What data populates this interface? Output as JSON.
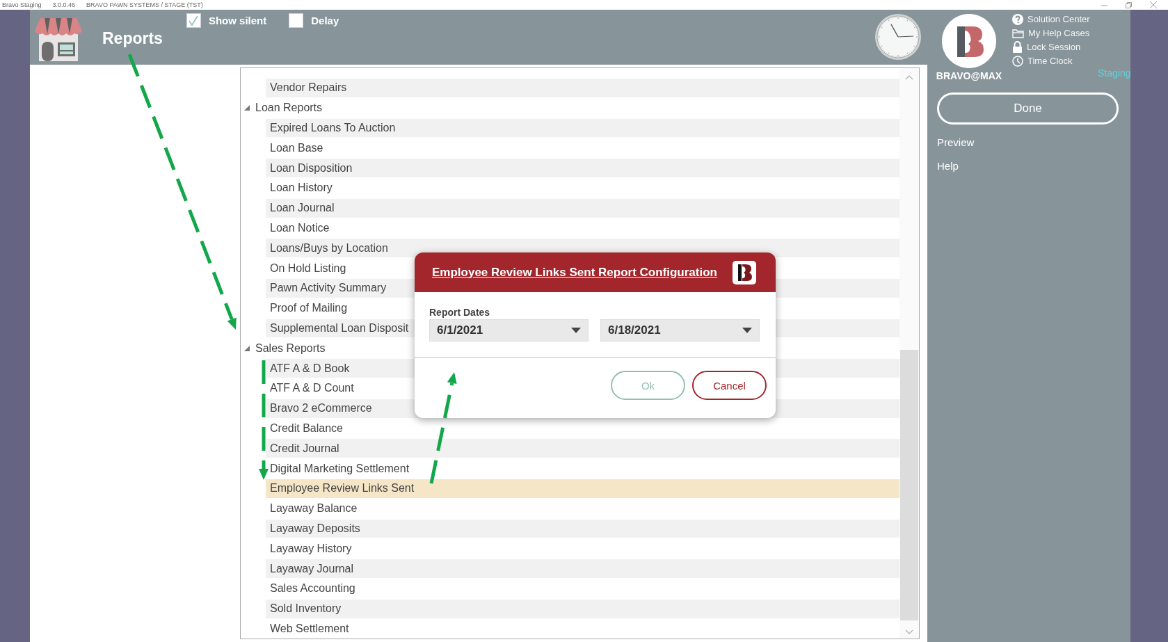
{
  "title_bar": {
    "app": "Bravo Staging",
    "version": "3.0.0.46",
    "system": "BRAVO PAWN SYSTEMS / STAGE (TST)"
  },
  "header": {
    "title": "Reports",
    "options": [
      {
        "label": "Show silent",
        "checked": true
      },
      {
        "label": "Delay",
        "checked": false
      }
    ]
  },
  "report_list": {
    "scrolled_group_items": [
      {
        "label": "Vendor Repairs",
        "selected": false
      }
    ],
    "groups": [
      {
        "label": "Loan Reports",
        "expanded": true,
        "children": [
          {
            "label": "Expired Loans To Auction",
            "selected": false
          },
          {
            "label": "Loan Base",
            "selected": false
          },
          {
            "label": "Loan Disposition",
            "selected": false
          },
          {
            "label": "Loan History",
            "selected": false
          },
          {
            "label": "Loan Journal",
            "selected": false
          },
          {
            "label": "Loan Notice",
            "selected": false
          },
          {
            "label": "Loans/Buys by Location",
            "selected": false
          },
          {
            "label": "On Hold Listing",
            "selected": false
          },
          {
            "label": "Pawn Activity Summary",
            "selected": false
          },
          {
            "label": "Proof of Mailing",
            "selected": false
          },
          {
            "label": "Supplemental Loan Disposit",
            "selected": false
          }
        ]
      },
      {
        "label": "Sales Reports",
        "expanded": true,
        "children": [
          {
            "label": "ATF A & D Book",
            "selected": false
          },
          {
            "label": "ATF A & D Count",
            "selected": false
          },
          {
            "label": "Bravo 2 eCommerce",
            "selected": false
          },
          {
            "label": "Credit Balance",
            "selected": false
          },
          {
            "label": "Credit Journal",
            "selected": false
          },
          {
            "label": "Digital Marketing Settlement",
            "selected": false
          },
          {
            "label": "Employee Review Links Sent",
            "selected": true
          },
          {
            "label": "Layaway Balance",
            "selected": false
          },
          {
            "label": "Layaway Deposits",
            "selected": false
          },
          {
            "label": "Layaway History",
            "selected": false
          },
          {
            "label": "Layaway Journal",
            "selected": false
          },
          {
            "label": "Sales Accounting",
            "selected": false
          },
          {
            "label": "Sold Inventory",
            "selected": false
          },
          {
            "label": "Web Settlement",
            "selected": false
          }
        ]
      }
    ]
  },
  "side_panel": {
    "brand": "BRAVO@MAX",
    "links": [
      {
        "label": "Solution Center",
        "kind": "help"
      },
      {
        "label": "My Help Cases",
        "kind": "folder"
      },
      {
        "label": "Lock Session",
        "kind": "lock"
      },
      {
        "label": "Time Clock",
        "kind": "clock"
      }
    ],
    "environment": "Staging",
    "done_button": "Done",
    "actions": [
      "Preview",
      "Help"
    ]
  },
  "dialog": {
    "title": "Employee Review Links Sent Report Configuration",
    "field_label": "Report Dates",
    "start_date": "6/1/2021",
    "end_date": "6/18/2021",
    "buttons": [
      {
        "label": "Ok",
        "kind": "ok",
        "disabled": true
      },
      {
        "label": "Cancel",
        "kind": "cancel",
        "disabled": false
      }
    ]
  }
}
